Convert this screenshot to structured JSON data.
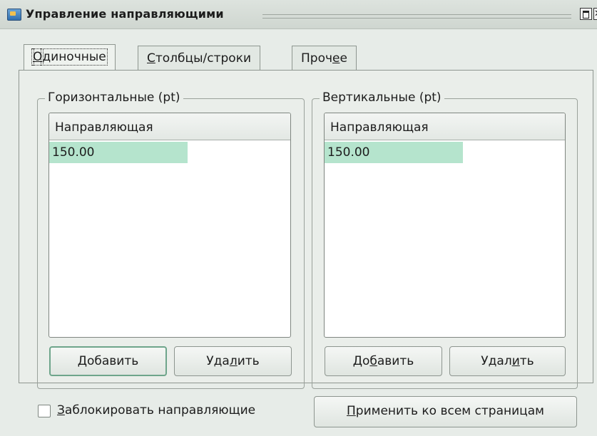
{
  "window": {
    "title": "Управление направляющими"
  },
  "tabs": [
    {
      "pre": "",
      "u": "О",
      "post": "диночные"
    },
    {
      "pre": "",
      "u": "С",
      "post": "толбцы/строки"
    },
    {
      "pre": "Проч",
      "u": "е",
      "post": "е"
    }
  ],
  "horizontal": {
    "group_title": "Горизонтальные (pt)",
    "column_header": "Направляющая",
    "rows": [
      "150.00"
    ],
    "add_button": {
      "pre": "",
      "u": "Д",
      "post": "обавить"
    },
    "remove_button": {
      "pre": "Уда",
      "u": "л",
      "post": "ить"
    }
  },
  "vertical": {
    "group_title": "Вертикальные (pt)",
    "column_header": "Направляющая",
    "rows": [
      "150.00"
    ],
    "add_button": {
      "pre": "До",
      "u": "б",
      "post": "авить"
    },
    "remove_button": {
      "pre": "Удал",
      "u": "и",
      "post": "ть"
    }
  },
  "lock_checkbox": {
    "pre": "",
    "u": "З",
    "post": "аблокировать направляющие",
    "checked": false
  },
  "apply_button": {
    "pre": "",
    "u": "П",
    "post": "рименить ко всем страницам"
  },
  "colors": {
    "selection": "#b5e4cd",
    "background": "#e7ece8",
    "focus_border": "#6ea58b"
  }
}
